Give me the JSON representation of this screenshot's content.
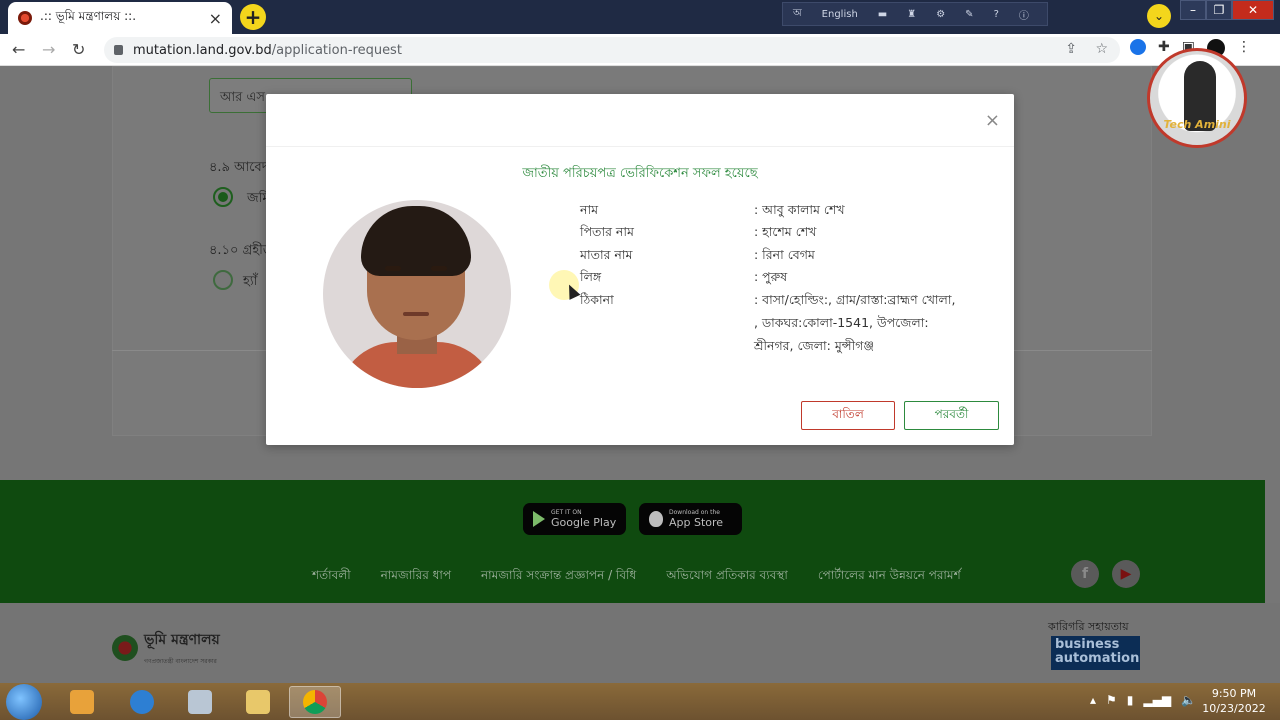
{
  "browser": {
    "tab_title": ".:: ভূমি মন্ত্রণালয় ::.",
    "tab_close": "×",
    "new_tab": "+",
    "url_host": "mutation.land.gov.bd",
    "url_path": "/application-request",
    "ime_language": "English",
    "ime_char": "অ"
  },
  "page": {
    "field_rs_placeholder": "আর এস",
    "q49_label": "৪.৯ আবেদ",
    "q49_option": "জমি",
    "q410_label": "৪.১০ গ্রহীত",
    "q410_option": "হ্যাঁ"
  },
  "modal": {
    "close": "×",
    "title": "জাতীয় পরিচয়পত্র ভেরিফিকেশন সফল হয়েছে",
    "fields": [
      {
        "label": "নাম",
        "value": ": আবু কালাম শেখ"
      },
      {
        "label": "পিতার নাম",
        "value": ": হাশেম শেখ"
      },
      {
        "label": "মাতার নাম",
        "value": ": রিনা বেগম"
      },
      {
        "label": "লিঙ্গ",
        "value": ": পুরুষ"
      },
      {
        "label": "ঠিকানা",
        "value": ": বাসা/হোল্ডিং:, গ্রাম/রাস্তা:ব্রাহ্মণ খোলা,"
      }
    ],
    "address_line2": ", ডাকঘর:কোলা-1541, উপজেলা:",
    "address_line3": "শ্রীনগর, জেলা: মুন্সীগঞ্জ",
    "cancel_label": "বাতিল",
    "next_label": "পরবর্তী"
  },
  "footer": {
    "google_play_small": "GET IT ON",
    "google_play": "Google Play",
    "app_store_small": "Download on the",
    "app_store": "App Store",
    "links": [
      "শর্তাবলী",
      "নামজারির ধাপ",
      "নামজারি সংক্রান্ত প্রজ্ঞাপন / বিধি",
      "অভিযোগ প্রতিকার ব্যবস্থা",
      "পোর্টালের মান উন্নয়নে পরামর্শ"
    ],
    "facebook": "f",
    "youtube": "▶",
    "ministry_name": "ভূমি মন্ত্রণালয়",
    "ministry_sub": "গণপ্রজাতন্ত্রী বাংলাদেশ সরকার",
    "tech_support": "কারিগরি সহায়তায়",
    "ba_line1": "business",
    "ba_line2": "automation"
  },
  "overlay": {
    "channel_name": "Tech Amini"
  },
  "taskbar": {
    "time": "9:50 PM",
    "date": "10/23/2022"
  },
  "colors": {
    "success_green": "#2d8a3e",
    "cancel_red": "#c0392b",
    "footer_green": "#0f4a0f"
  }
}
